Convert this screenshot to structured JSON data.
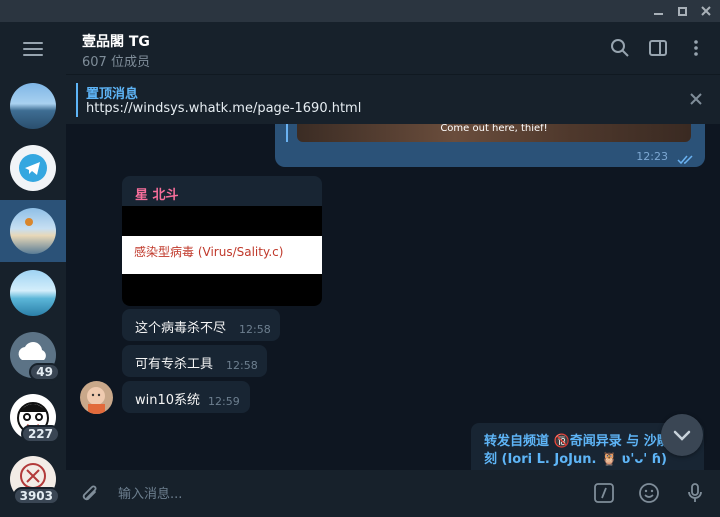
{
  "header": {
    "title": "壹品閣 TG",
    "subtitle": "607 位成员"
  },
  "pinned": {
    "title": "置顶消息",
    "text": "https://windsys.whatk.me/page-1690.html"
  },
  "rail": {
    "badges": [
      "49",
      "227",
      "3903"
    ]
  },
  "messages": {
    "outgoing": {
      "caption": "Come out here, thief!",
      "time": "12:23"
    },
    "image_message": {
      "sender": "星 北斗",
      "virus_text": "感染型病毒 (Virus/Sality.c)"
    },
    "text_messages": [
      {
        "text": "这个病毒杀不尽",
        "time": "12:58"
      },
      {
        "text": "可有专杀工具",
        "time": "12:58"
      },
      {
        "text": "win10系统",
        "time": "12:59"
      }
    ],
    "forwarded": {
      "line1": "转发自频道 🔞奇闻异录 与 沙雕",
      "line2": "刻 (Iori L. JoJun. 🦉 ʋ'ᴗ' ɦ)"
    }
  },
  "composer": {
    "placeholder": "输入消息..."
  },
  "colors": {
    "accent": "#5eb5f7",
    "sender": "#f76e9b",
    "outgoing_bubble": "#2b5278",
    "incoming_bubble": "#182533",
    "chat_bg": "#0e1621"
  }
}
